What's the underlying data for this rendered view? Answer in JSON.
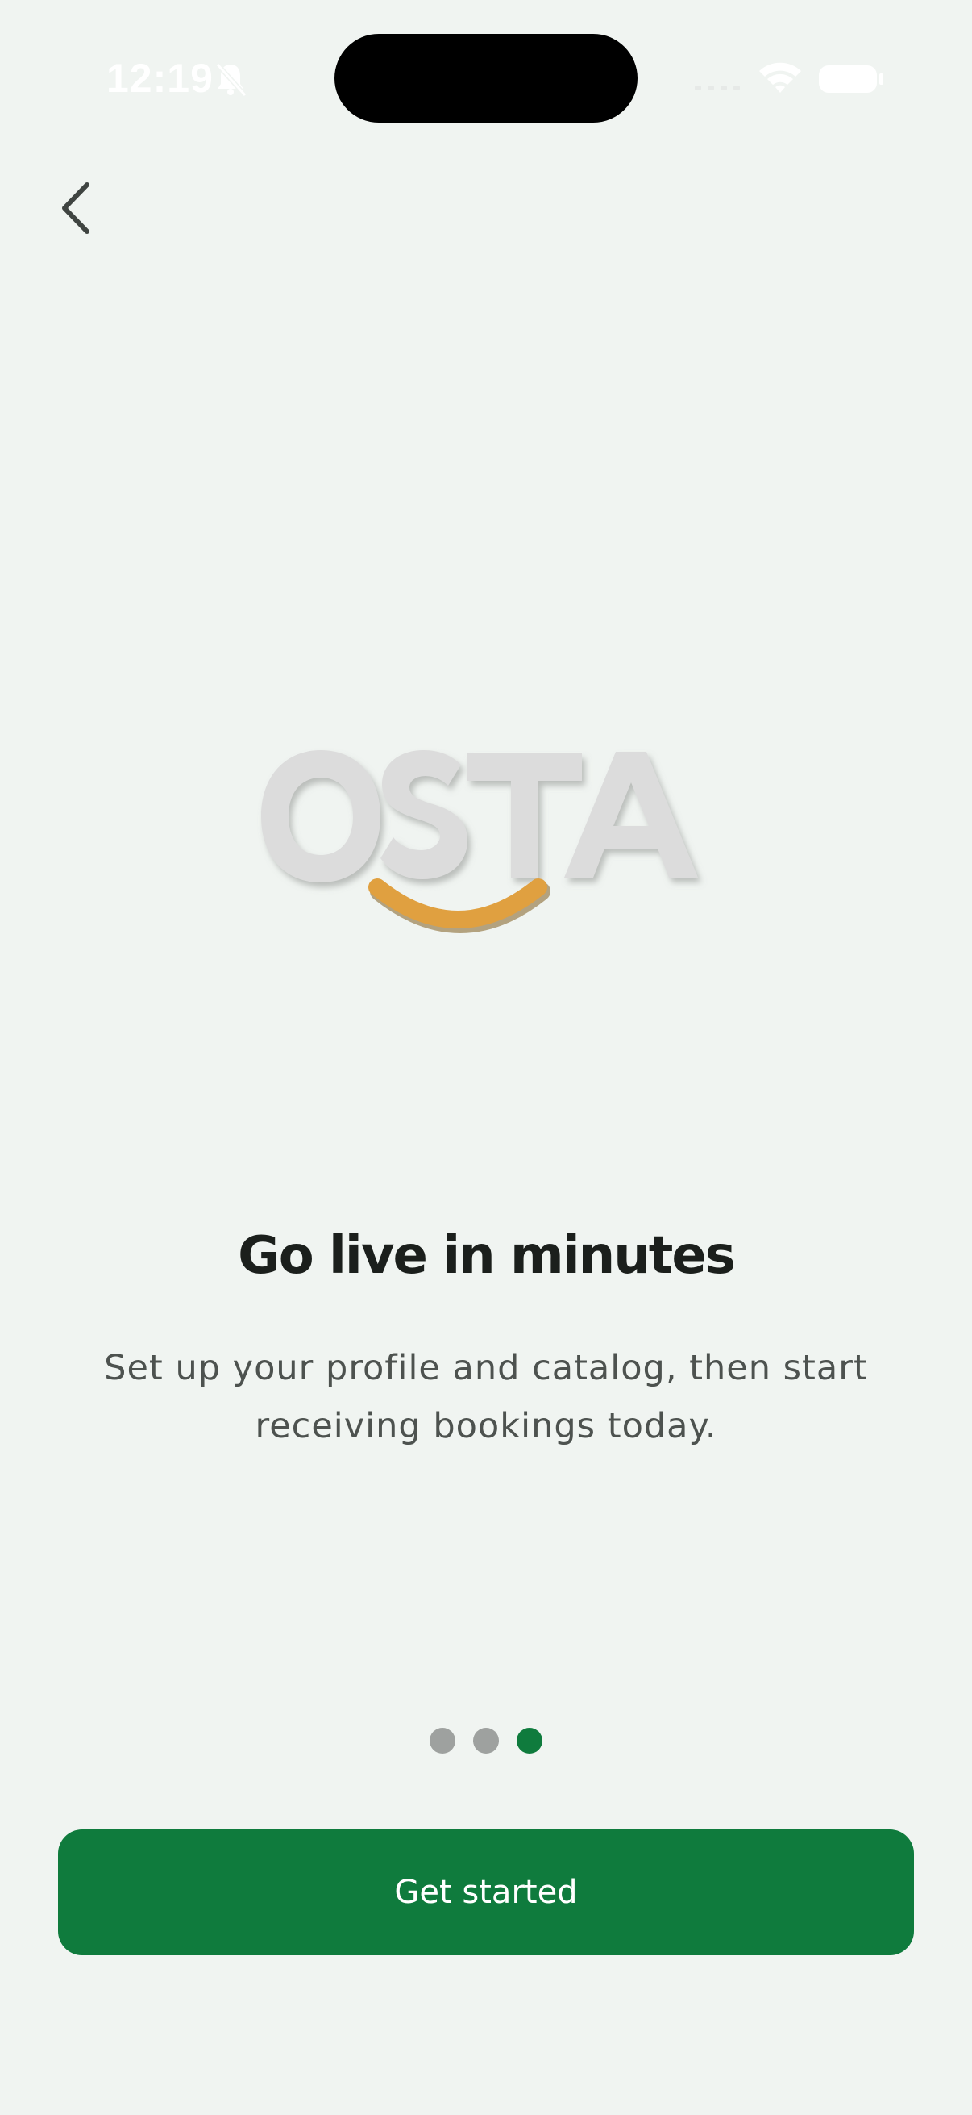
{
  "status_bar": {
    "time": "12:19",
    "icons": [
      "bell-slash-icon",
      "cellular-signal-icon",
      "wifi-icon",
      "battery-icon"
    ]
  },
  "nav": {
    "back_icon": "chevron-left-icon"
  },
  "logo": {
    "text": "OSTA",
    "colors": {
      "letters": "#dcdcdc",
      "smile": "#e0a040"
    }
  },
  "onboarding": {
    "title": "Go live in minutes",
    "description": "Set up your profile and catalog, then start receiving bookings today.",
    "page_indicator": {
      "total": 3,
      "current": 3
    }
  },
  "cta": {
    "label": "Get started"
  },
  "colors": {
    "background": "#f0f4f1",
    "accent": "#0f7b3d",
    "dot_inactive": "#9ea19f",
    "title": "#1b1f1c",
    "body_text": "#4d524f"
  }
}
